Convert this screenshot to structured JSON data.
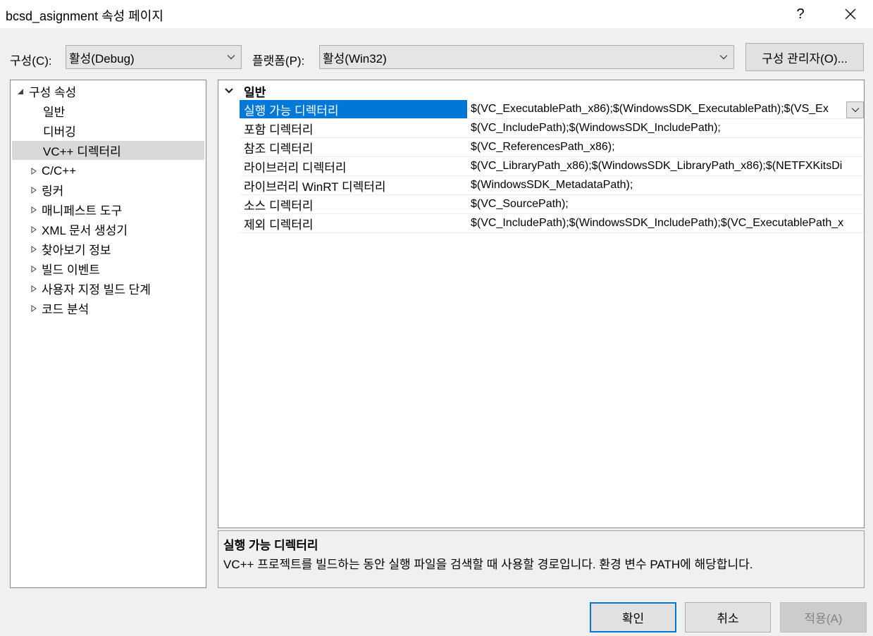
{
  "window": {
    "title": "bcsd_asignment 속성 페이지",
    "help_label": "?"
  },
  "toolbar": {
    "config_label": "구성(C):",
    "config_value": "활성(Debug)",
    "platform_label": "플랫폼(P):",
    "platform_value": "활성(Win32)",
    "config_manager_label": "구성 관리자(O)..."
  },
  "tree": {
    "root": "구성 속성",
    "children": [
      "일반",
      "디버깅",
      "VC++ 디렉터리"
    ],
    "selected": "VC++ 디렉터리",
    "collapsed": [
      "C/C++",
      "링커",
      "매니페스트 도구",
      "XML 문서 생성기",
      "찾아보기 정보",
      "빌드 이벤트",
      "사용자 지정 빌드 단계",
      "코드 분석"
    ]
  },
  "grid": {
    "category": "일반",
    "rows": [
      {
        "name": "실행 가능 디렉터리",
        "value": "$(VC_ExecutablePath_x86);$(WindowsSDK_ExecutablePath);$(VS_Ex"
      },
      {
        "name": "포함 디렉터리",
        "value": "$(VC_IncludePath);$(WindowsSDK_IncludePath);"
      },
      {
        "name": "참조 디렉터리",
        "value": "$(VC_ReferencesPath_x86);"
      },
      {
        "name": "라이브러리 디렉터리",
        "value": "$(VC_LibraryPath_x86);$(WindowsSDK_LibraryPath_x86);$(NETFXKitsDi"
      },
      {
        "name": "라이브러리 WinRT 디렉터리",
        "value": "$(WindowsSDK_MetadataPath);"
      },
      {
        "name": "소스 디렉터리",
        "value": "$(VC_SourcePath);"
      },
      {
        "name": "제외 디렉터리",
        "value": "$(VC_IncludePath);$(WindowsSDK_IncludePath);$(VC_ExecutablePath_x"
      }
    ]
  },
  "description": {
    "title": "실행 가능 디렉터리",
    "text": "VC++ 프로젝트를 빌드하는 동안 실행 파일을 검색할 때 사용할 경로입니다.  환경 변수 PATH에 해당합니다."
  },
  "buttons": {
    "ok": "확인",
    "cancel": "취소",
    "apply": "적용(A)"
  },
  "colors": {
    "accent": "#0078d7",
    "selected_tree": "#d9d9d9",
    "disabled_text": "#838383"
  }
}
